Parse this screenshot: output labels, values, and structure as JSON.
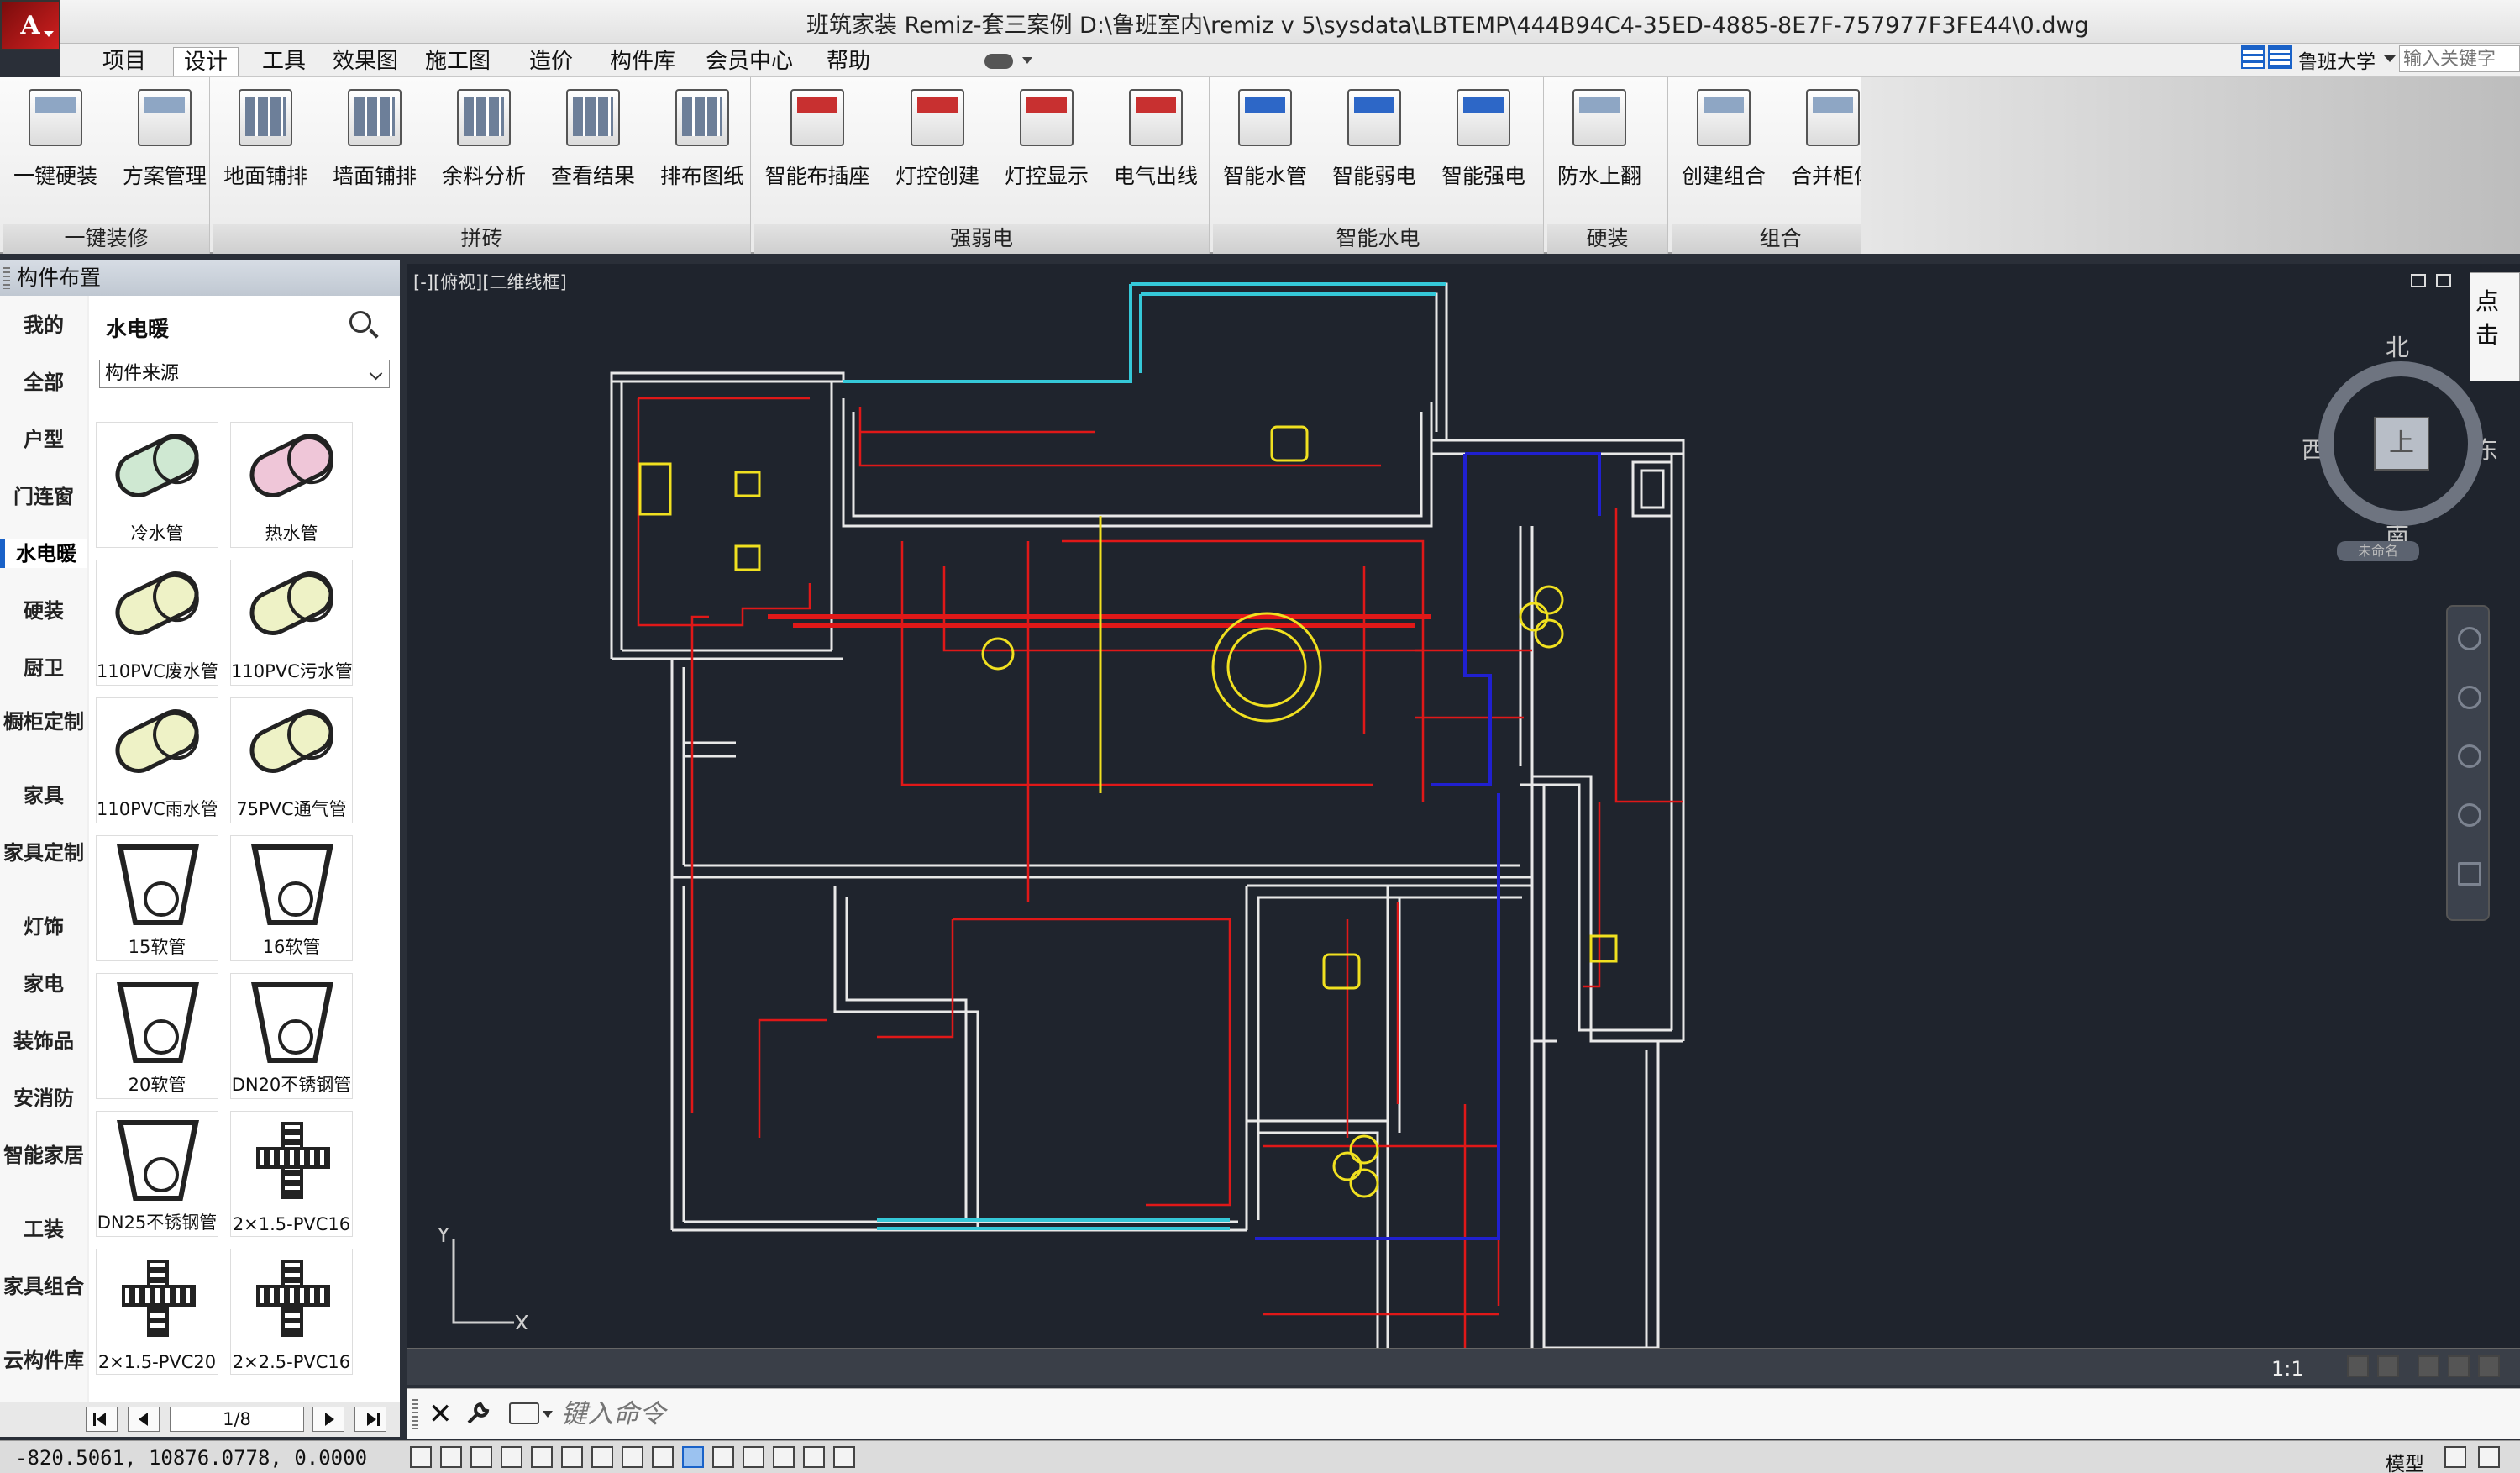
{
  "window": {
    "title": "班筑家装 Remiz-套三案例    D:\\鲁班室内\\remiz v 5\\sysdata\\LBTEMP\\444B94C4-35ED-4885-8E7F-757977F3FE44\\0.dwg",
    "logo_letter": "A"
  },
  "menu": {
    "items": [
      "项目",
      "设计",
      "工具",
      "效果图",
      "施工图",
      "造价",
      "构件库",
      "会员中心",
      "帮助"
    ],
    "active": "设计",
    "user": "鲁班大学",
    "search_placeholder": "输入关键字"
  },
  "ribbon": {
    "groups": [
      {
        "label": "一键装修",
        "buttons": [
          "一键硬装",
          "方案管理"
        ]
      },
      {
        "label": "拼砖",
        "buttons": [
          "地面铺排",
          "墙面铺排",
          "余料分析",
          "查看结果",
          "排布图纸"
        ]
      },
      {
        "label": "强弱电",
        "buttons": [
          "智能布插座",
          "灯控创建",
          "灯控显示",
          "电气出线"
        ]
      },
      {
        "label": "智能水电",
        "buttons": [
          "智能水管",
          "智能弱电",
          "智能强电"
        ]
      },
      {
        "label": "硬装",
        "buttons": [
          "防水上翻"
        ]
      },
      {
        "label": "组合",
        "buttons": [
          "创建组合",
          "合并柜体"
        ]
      }
    ]
  },
  "panel": {
    "title": "构件布置",
    "categories": [
      "我的",
      "全部",
      "户型",
      "门连窗",
      "水电暖",
      "硬装",
      "厨卫",
      "橱柜定制",
      "家具",
      "家具定制",
      "灯饰",
      "家电",
      "装饰品",
      "安消防",
      "智能家居",
      "工装",
      "家具组合",
      "云构件库"
    ],
    "active_category": "水电暖",
    "section_title": "水电暖",
    "source_select": "构件来源",
    "items": [
      "冷水管",
      "热水管",
      "110PVC废水管",
      "110PVC污水管",
      "110PVC雨水管",
      "75PVC通气管",
      "15软管",
      "16软管",
      "20软管",
      "DN20不锈钢管",
      "DN25不锈钢管",
      "2×1.5-PVC16",
      "2×1.5-PVC20",
      "2×2.5-PVC16"
    ],
    "item_icons": [
      "pipe-green",
      "pipe-pink",
      "pipe-yellow",
      "pipe-yellow",
      "pipe-yellow",
      "pipe-yellow",
      "bucket",
      "bucket",
      "bucket",
      "bucket",
      "bucket",
      "cross",
      "cross",
      "cross"
    ],
    "page": "1/8"
  },
  "viewport": {
    "label": "[-][俯视][二维线框]",
    "compass": {
      "north": "北",
      "south": "南",
      "east": "东",
      "west": "西",
      "center": "上"
    },
    "ucs_name": "未命名",
    "axis_x": "X",
    "axis_y": "Y",
    "side_tab": "点击",
    "scale": "1:1"
  },
  "command": {
    "placeholder": "键入命令"
  },
  "status": {
    "coords": "-820.5061,  10876.0778, 0.0000",
    "model": "模型"
  },
  "colors": {
    "canvas_bg": "#1f242d",
    "wall": "#e8e8e8",
    "electric": "#e01818",
    "water": "#2020d0",
    "window": "#35c8d8",
    "fixture": "#f0e020"
  }
}
